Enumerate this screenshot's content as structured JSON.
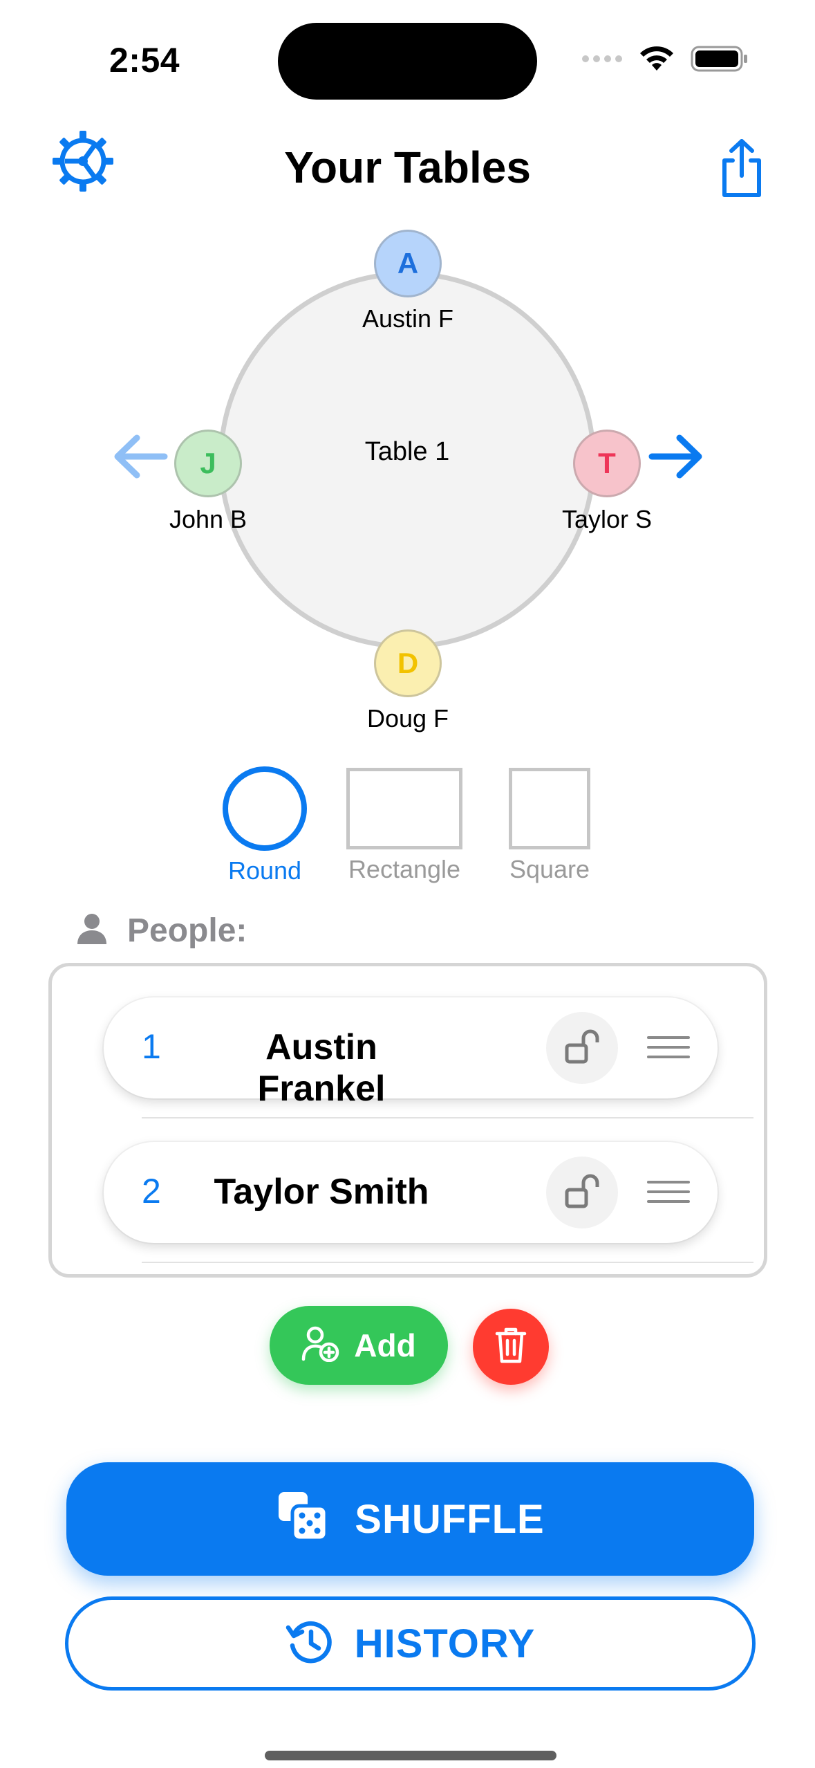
{
  "status_bar": {
    "time": "2:54"
  },
  "header": {
    "title": "Your Tables",
    "settings_icon": "gear-icon",
    "share_icon": "share-icon"
  },
  "table": {
    "name": "Table 1",
    "seats": [
      {
        "initial": "A",
        "label": "Austin F",
        "color": "#1d6fdc"
      },
      {
        "initial": "J",
        "label": "John B",
        "color": "#3cbd5c"
      },
      {
        "initial": "T",
        "label": "Taylor S",
        "color": "#ee3558"
      },
      {
        "initial": "D",
        "label": "Doug F",
        "color": "#f2c200"
      }
    ]
  },
  "shapes": [
    {
      "label": "Round",
      "selected": true
    },
    {
      "label": "Rectangle",
      "selected": false
    },
    {
      "label": "Square",
      "selected": false
    }
  ],
  "people": {
    "title": "People:",
    "items": [
      {
        "number": "1",
        "name": "Austin Frankel",
        "locked": false
      },
      {
        "number": "2",
        "name": "Taylor Smith",
        "locked": false
      }
    ]
  },
  "actions": {
    "add_label": "Add",
    "shuffle_label": "SHUFFLE",
    "history_label": "HISTORY"
  },
  "colors": {
    "accent": "#0a7af0",
    "add": "#34c759",
    "delete": "#ff3b30"
  }
}
